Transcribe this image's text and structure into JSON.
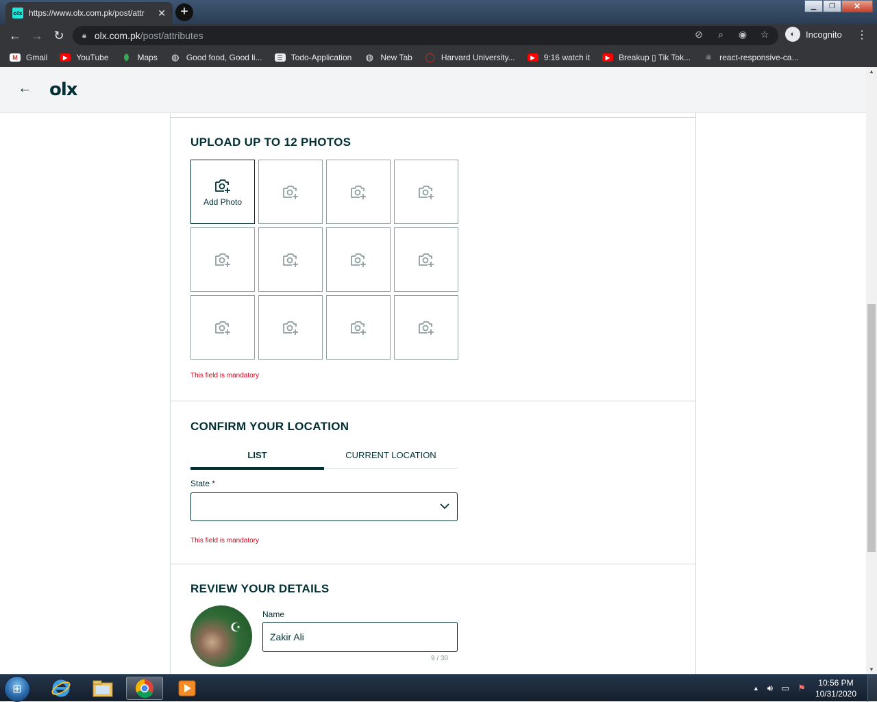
{
  "browser": {
    "tab_title": "https://www.olx.com.pk/post/attr",
    "tab_favicon": "olx",
    "url_host": "olx.com.pk",
    "url_path": "/post/attributes",
    "incognito_label": "Incognito",
    "bookmarks": [
      {
        "label": "Gmail",
        "icon": "gmail-icon"
      },
      {
        "label": "YouTube",
        "icon": "youtube-icon"
      },
      {
        "label": "Maps",
        "icon": "maps-icon"
      },
      {
        "label": "Good food, Good li...",
        "icon": "globe-icon"
      },
      {
        "label": "Todo-Application",
        "icon": "todo-icon"
      },
      {
        "label": "New Tab",
        "icon": "globe-icon"
      },
      {
        "label": "Harvard University...",
        "icon": "harvard-icon"
      },
      {
        "label": "9:16 watch it",
        "icon": "youtube-icon"
      },
      {
        "label": "Breakup ▯ Tik Tok...",
        "icon": "youtube-icon"
      },
      {
        "label": "react-responsive-ca...",
        "icon": "react-icon"
      }
    ]
  },
  "header": {
    "logo_text": "olx"
  },
  "photos": {
    "title": "UPLOAD UP TO 12 PHOTOS",
    "add_label": "Add Photo",
    "slot_count": 12,
    "error": "This field is mandatory"
  },
  "location": {
    "title": "CONFIRM YOUR LOCATION",
    "tabs": [
      "LIST",
      "CURRENT LOCATION"
    ],
    "active_tab": "LIST",
    "state_label": "State *",
    "state_value": "",
    "error": "This field is mandatory"
  },
  "details": {
    "title": "REVIEW YOUR DETAILS",
    "name_label": "Name",
    "name_value": "Zakir Ali",
    "char_count": "9 / 30"
  },
  "taskbar": {
    "time": "10:56 PM",
    "date": "10/31/2020"
  },
  "colors": {
    "brand_dark": "#002f34",
    "error": "#d0021b",
    "olx_teal": "#23e5db"
  }
}
